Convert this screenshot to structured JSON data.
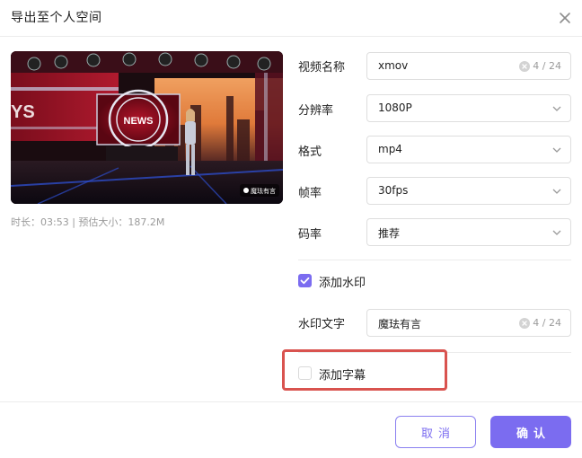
{
  "dialog": {
    "title": "导出至个人空间",
    "close_icon": "close-icon"
  },
  "preview": {
    "news_text": "NEWS",
    "side_text": "YS",
    "watermark_text": "魔珐有言",
    "meta": "时长：03:53 | 预估大小：187.2M"
  },
  "form": {
    "name": {
      "label": "视频名称",
      "value": "xmov",
      "count": "4 / 24"
    },
    "resolution": {
      "label": "分辨率",
      "value": "1080P"
    },
    "format": {
      "label": "格式",
      "value": "mp4"
    },
    "framerate": {
      "label": "帧率",
      "value": "30fps"
    },
    "bitrate": {
      "label": "码率",
      "value": "推荐"
    },
    "watermark": {
      "label": "添加水印",
      "checked": true
    },
    "watermark_text": {
      "label": "水印文字",
      "value": "魔珐有言",
      "count": "4 / 24"
    },
    "subtitle": {
      "label": "添加字幕",
      "checked": false
    }
  },
  "buttons": {
    "cancel": "取消",
    "confirm": "确认"
  },
  "colors": {
    "accent": "#7b6cf0",
    "highlight_border": "#d9534f"
  }
}
